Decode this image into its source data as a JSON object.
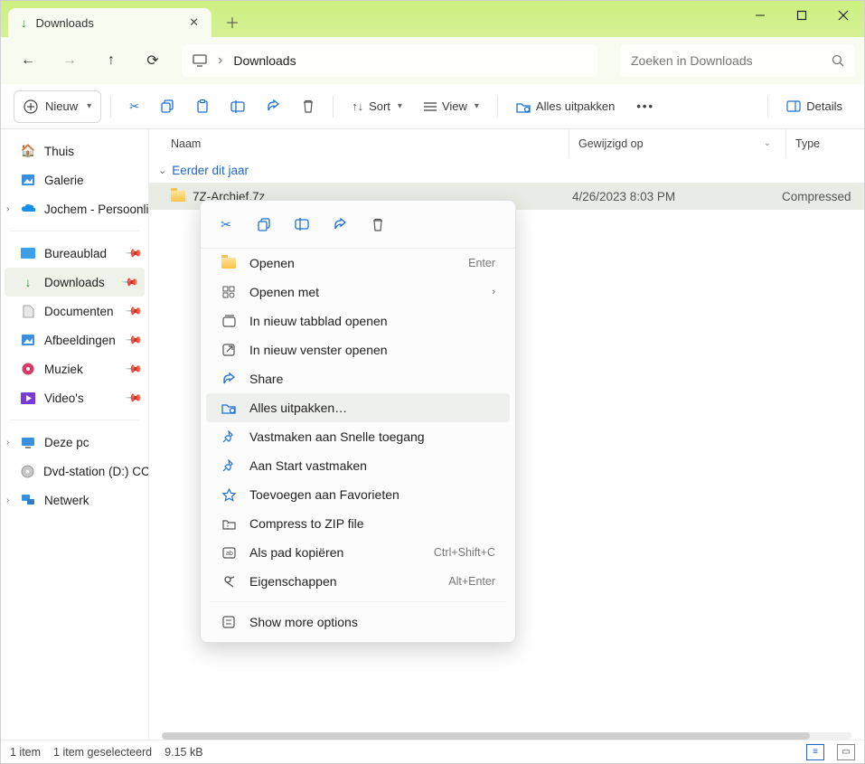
{
  "window": {
    "title": "Downloads"
  },
  "nav": {
    "breadcrumb": "Downloads"
  },
  "search": {
    "placeholder": "Zoeken in Downloads"
  },
  "toolbar": {
    "new_label": "Nieuw",
    "sort_label": "Sort",
    "view_label": "View",
    "extract_label": "Alles uitpakken",
    "details_label": "Details"
  },
  "sidebar": {
    "home": "Thuis",
    "gallery": "Galerie",
    "onedrive": "Jochem - Persoonli",
    "quick": {
      "desktop": "Bureaublad",
      "downloads": "Downloads",
      "documents": "Documenten",
      "pictures": "Afbeeldingen",
      "music": "Muziek",
      "videos": "Video's"
    },
    "thispc": "Deze pc",
    "dvd": "Dvd-station (D:) CC",
    "network": "Netwerk"
  },
  "columns": {
    "name": "Naam",
    "modified": "Gewijzigd op",
    "type": "Type"
  },
  "group": {
    "label": "Eerder dit jaar"
  },
  "file": {
    "name": "7Z-Archief.7z",
    "modified": "4/26/2023 8:03 PM",
    "type": "Compressed"
  },
  "ctx": {
    "open": "Openen",
    "open_hint": "Enter",
    "openwith": "Openen met",
    "newtab": "In nieuw tabblad openen",
    "newwin": "In nieuw venster openen",
    "share": "Share",
    "extract": "Alles uitpakken…",
    "pinquick": "Vastmaken aan Snelle toegang",
    "pinstart": "Aan Start vastmaken",
    "favorites": "Toevoegen aan Favorieten",
    "zip": "Compress to ZIP file",
    "copypath": "Als pad kopiëren",
    "copypath_hint": "Ctrl+Shift+C",
    "properties": "Eigenschappen",
    "properties_hint": "Alt+Enter",
    "more": "Show more options"
  },
  "status": {
    "count": "1 item",
    "selected": "1 item geselecteerd",
    "size": "9.15 kB"
  }
}
